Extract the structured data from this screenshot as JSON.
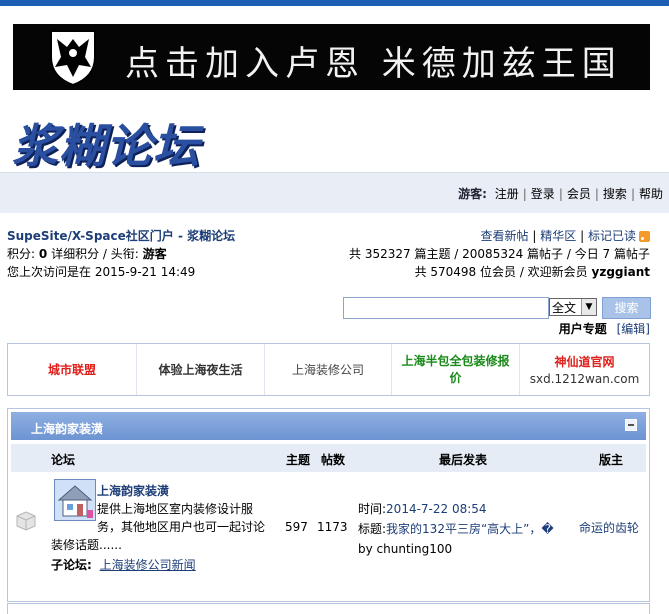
{
  "banner": {
    "text": "点击加入卢恩 米德加兹王国"
  },
  "logo": {
    "text": "浆糊论坛"
  },
  "nav": {
    "guest_label": "游客:",
    "links": [
      "注册",
      "登录",
      "会员",
      "搜索",
      "帮助"
    ]
  },
  "info": {
    "breadcrumb": "SupeSite/X-Space社区门户 - 浆糊论坛",
    "points_label": "积分:",
    "points_value": "0",
    "detail_label": "详细积分",
    "title_label": "头衔:",
    "title_value": "游客",
    "last_visit": "您上次访问是在 2015-9-21 14:49",
    "top_links": [
      "查看新帖",
      "精华区",
      "标记已读"
    ],
    "stats_line1": "共 352327 篇主题 / 20085324 篇帖子 / 今日 7 篇帖子",
    "stats_line2_prefix": "共 570498 位会员 / 欢迎新会员",
    "stats_newest_member": "yzggiant"
  },
  "search": {
    "input_value": "",
    "select_value": "全文",
    "button_label": "搜索",
    "user_topic_label": "用户专题",
    "edit_label": "[编辑]"
  },
  "friend_links": [
    {
      "text": "城市联盟",
      "color": "#e0201c",
      "bold": true
    },
    {
      "text": "体验上海夜生活",
      "color": "#333333",
      "bold": true
    },
    {
      "text": "上海装修公司",
      "color": "#444444",
      "bold": false
    },
    {
      "text": "上海半包全包装修报价",
      "color": "#1a8a1a",
      "bold": true
    },
    {
      "text": "神仙道官网",
      "sub": "sxd.1212wan.com",
      "color": "#e0201c",
      "bold": true
    }
  ],
  "forum_group": {
    "title": "上海韵家装潢",
    "columns": {
      "forum": "论坛",
      "topics": "主题",
      "posts": "帖数",
      "last_post": "最后发表",
      "moderator": "版主"
    },
    "forum": {
      "name": "上海韵家装潢",
      "desc_line1": "提供上海地区室内装修设计服",
      "desc_line2": "务，其他地区用户也可一起讨论",
      "desc_line3": "装修话题......",
      "subforum_label": "子论坛:",
      "subforum_link": "上海装修公司新闻",
      "topics": "597",
      "posts": "1173",
      "last_time_label": "时间:",
      "last_time": "2014-7-22 08:54",
      "last_title_label": "标题:",
      "last_title": "我家的132平三房“高大上”，�",
      "last_by_label": "by",
      "last_by": "chunting100",
      "moderator": "命运的齿轮"
    }
  }
}
